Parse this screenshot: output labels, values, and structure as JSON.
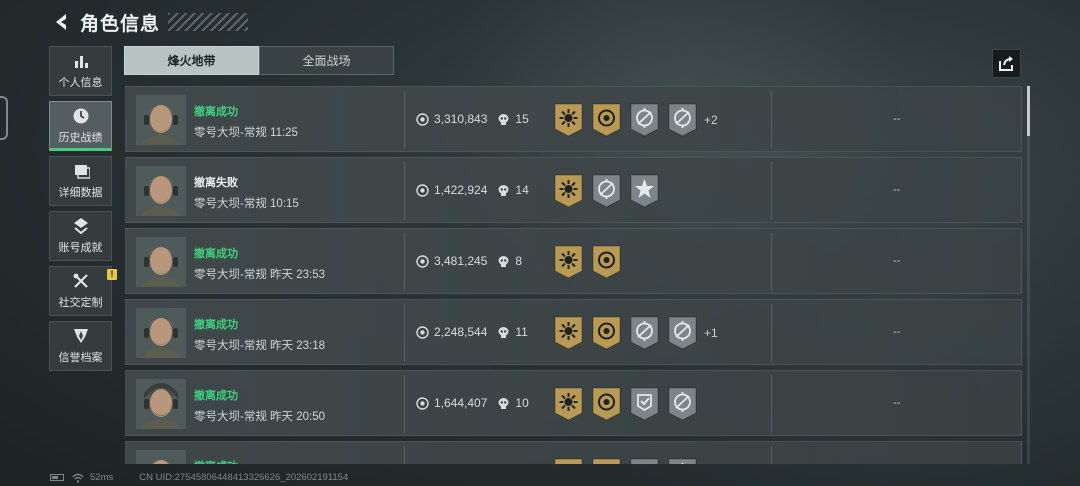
{
  "header": {
    "title": "角色信息"
  },
  "sidebar": {
    "items": [
      {
        "label": "个人信息",
        "icon": "bar-chart-icon"
      },
      {
        "label": "历史战绩",
        "icon": "clock-icon",
        "active": true
      },
      {
        "label": "详细数据",
        "icon": "data-icon"
      },
      {
        "label": "账号成就",
        "icon": "achievement-icon"
      },
      {
        "label": "社交定制",
        "icon": "tools-icon",
        "badge": "!"
      },
      {
        "label": "信誉档案",
        "icon": "shield-icon"
      }
    ]
  },
  "tabs": [
    {
      "label": "烽火地带",
      "active": true
    },
    {
      "label": "全面战场",
      "active": false
    }
  ],
  "rows": [
    {
      "status": "撤离成功",
      "success": true,
      "map": "零号大坝-常规 11:25",
      "value": "3,310,843",
      "kills": "15",
      "badges": [
        "gold-sun",
        "gold-target",
        "gray-crosshair",
        "gray-crosshair"
      ],
      "extra": "+2",
      "result": "--"
    },
    {
      "status": "撤离失败",
      "success": false,
      "map": "零号大坝-常规 10:15",
      "value": "1,422,924",
      "kills": "14",
      "badges": [
        "gold-sun",
        "gray-crosshair",
        "gray-star"
      ],
      "extra": "",
      "result": "--"
    },
    {
      "status": "撤离成功",
      "success": true,
      "map": "零号大坝-常规 昨天 23:53",
      "value": "3,481,245",
      "kills": "8",
      "badges": [
        "gold-sun",
        "gold-target"
      ],
      "extra": "",
      "result": "--"
    },
    {
      "status": "撤离成功",
      "success": true,
      "map": "零号大坝-常规 昨天 23:18",
      "value": "2,248,544",
      "kills": "11",
      "badges": [
        "gold-sun",
        "gold-target",
        "gray-crosshair",
        "gray-crosshair"
      ],
      "extra": "+1",
      "result": "--"
    },
    {
      "status": "撤离成功",
      "success": true,
      "map": "零号大坝-常规 昨天 20:50",
      "value": "1,644,407",
      "kills": "10",
      "badges": [
        "gold-sun",
        "gold-target",
        "gray-check",
        "gray-crosshair"
      ],
      "extra": "",
      "result": "--"
    },
    {
      "status": "撤离成功",
      "success": true,
      "map": "",
      "value": "",
      "kills": "",
      "badges": [
        "gold-sun",
        "gold-target",
        "gray-check",
        "gray-crosshair"
      ],
      "extra": "",
      "result": ""
    }
  ],
  "footer": {
    "ping": "52ms",
    "uid": "CN UID:2754580644841332662​6_202602191154"
  },
  "colors": {
    "success": "#3fd07f",
    "gold": "#b89a55",
    "gray_badge": "#7c8688"
  }
}
